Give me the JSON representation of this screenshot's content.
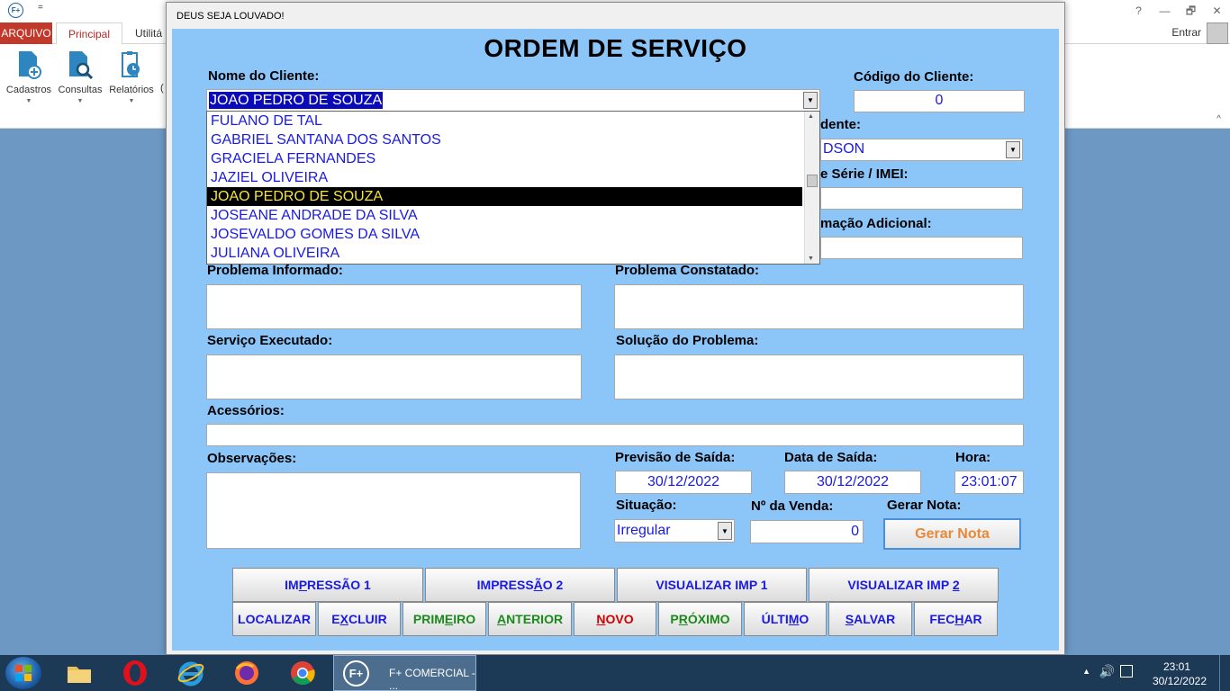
{
  "app": {
    "logo": "F+",
    "quick_access": "=",
    "controls": [
      "?",
      "—",
      "🗗",
      "✕"
    ],
    "entrar_label": "Entrar"
  },
  "ribbon": {
    "tabs": [
      "ARQUIVO",
      "Principal",
      "Utilitá"
    ],
    "buttons": [
      {
        "label": "Cadastros",
        "icon": "document-add-icon"
      },
      {
        "label": "Consultas",
        "icon": "search-document-icon"
      },
      {
        "label": "Relatórios",
        "icon": "report-clock-icon"
      }
    ],
    "partial_label": "("
  },
  "modal": {
    "window_title": "DEUS SEJA LOUVADO!",
    "form_title": "ORDEM DE SERVIÇO",
    "labels": {
      "nome_cliente": "Nome do Cliente:",
      "codigo_cliente": "Código do Cliente:",
      "atendente": "dente:",
      "serie_imei": "e Série / IMEI:",
      "info_adicional": "mação Adicional:",
      "problema_informado": "Problema Informado:",
      "problema_constatado": "Problema Constatado:",
      "servico_executado": "Serviço Executado:",
      "solucao_problema": "Solução do Problema:",
      "acessorios": "Acessórios:",
      "observacoes": "Observações:",
      "previsao_saida": "Previsão de Saída:",
      "data_saida": "Data de Saída:",
      "hora": "Hora:",
      "situacao": "Situação:",
      "numero_venda": "Nº da Venda:",
      "gerar_nota": "Gerar Nota:"
    },
    "values": {
      "cliente_selected": "JOAO PEDRO DE SOUZA",
      "codigo_cliente": "0",
      "atendente": "DSON",
      "previsao_saida": "30/12/2022",
      "data_saida": "30/12/2022",
      "hora": "23:01:07",
      "situacao": "Irregular",
      "numero_venda": "0"
    },
    "client_options": [
      "FULANO DE TAL",
      "GABRIEL SANTANA DOS SANTOS",
      "GRACIELA FERNANDES",
      "JAZIEL OLIVEIRA",
      "JOAO PEDRO DE SOUZA",
      "JOSEANE ANDRADE DA SILVA",
      "JOSEVALDO GOMES DA SILVA",
      "JULIANA OLIVEIRA"
    ],
    "selected_option": "JOAO PEDRO DE SOUZA",
    "gerar_nota_button": "Gerar Nota",
    "print_buttons": [
      {
        "pre": "IM",
        "u": "P",
        "post": "RESSÃO 1"
      },
      {
        "pre": "IMPRESS",
        "u": "Ã",
        "post": "O 2"
      },
      {
        "pre": "VISUALIZAR IMP 1",
        "u": "",
        "post": ""
      },
      {
        "pre": "VISUALIZAR IMP ",
        "u": "2",
        "post": ""
      }
    ],
    "nav_buttons": [
      {
        "pre": "LOCALIZAR",
        "u": "",
        "post": "",
        "color": "blue"
      },
      {
        "pre": "E",
        "u": "X",
        "post": "CLUIR",
        "color": "blue"
      },
      {
        "pre": "PRIM",
        "u": "E",
        "post": "IRO",
        "color": "green"
      },
      {
        "pre": "",
        "u": "A",
        "post": "NTERIOR",
        "color": "green"
      },
      {
        "pre": "",
        "u": "N",
        "post": "OVO",
        "color": "red"
      },
      {
        "pre": "P",
        "u": "R",
        "post": "ÓXIMO",
        "color": "green"
      },
      {
        "pre": "ÚLTI",
        "u": "M",
        "post": "O",
        "color": "blue"
      },
      {
        "pre": "",
        "u": "S",
        "post": "ALVAR",
        "color": "blue"
      },
      {
        "pre": "FEC",
        "u": "H",
        "post": "AR",
        "color": "blue"
      }
    ]
  },
  "taskbar": {
    "app_task_label": "F+ COMERCIAL - ...",
    "app_task_logo": "F+",
    "time": "23:01",
    "date": "30/12/2022",
    "pinned": [
      "windows-explorer-icon",
      "opera-icon",
      "internet-explorer-icon",
      "firefox-icon",
      "chrome-icon"
    ]
  }
}
